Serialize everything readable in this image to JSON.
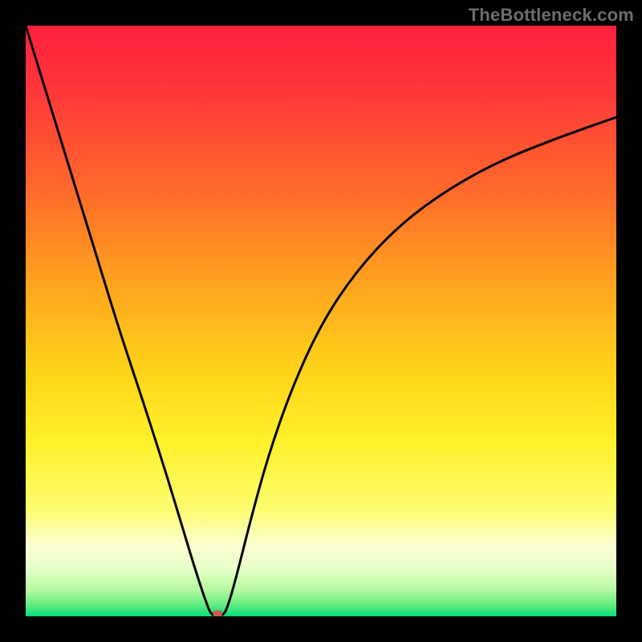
{
  "watermark": "TheBottleneck.com",
  "chart_data": {
    "type": "line",
    "title": "",
    "xlabel": "",
    "ylabel": "",
    "xlim": [
      0,
      100
    ],
    "ylim": [
      0,
      100
    ],
    "grid": false,
    "marker": {
      "x": 32.5,
      "y": 0,
      "color": "#c95c4f",
      "rx": 6,
      "ry": 5
    },
    "gradient_stops": [
      {
        "offset": 0.0,
        "color": "#ff1f3e"
      },
      {
        "offset": 0.12,
        "color": "#ff3a3a"
      },
      {
        "offset": 0.28,
        "color": "#ff6a2a"
      },
      {
        "offset": 0.44,
        "color": "#ffa51f"
      },
      {
        "offset": 0.58,
        "color": "#ffd21a"
      },
      {
        "offset": 0.7,
        "color": "#fff028"
      },
      {
        "offset": 0.82,
        "color": "#fdfd70"
      },
      {
        "offset": 0.88,
        "color": "#fcfed3"
      },
      {
        "offset": 0.92,
        "color": "#e6ffc8"
      },
      {
        "offset": 0.955,
        "color": "#b6f9a1"
      },
      {
        "offset": 0.978,
        "color": "#6dee82"
      },
      {
        "offset": 1.0,
        "color": "#06de7b"
      }
    ],
    "series": [
      {
        "name": "curve",
        "color": "#000000",
        "x": [
          0.0,
          4.0,
          8.0,
          12.0,
          16.0,
          20.0,
          24.0,
          27.0,
          29.0,
          30.5,
          31.5,
          33.5,
          34.5,
          36.0,
          38.0,
          41.0,
          45.0,
          50.0,
          56.0,
          63.0,
          71.0,
          80.0,
          90.0,
          100.0
        ],
        "y": [
          100.0,
          87.0,
          74.0,
          61.0,
          48.0,
          36.0,
          23.5,
          13.5,
          7.0,
          2.5,
          0.0,
          0.0,
          2.5,
          8.0,
          16.0,
          27.0,
          38.5,
          49.5,
          58.5,
          66.0,
          72.0,
          77.0,
          81.0,
          84.5
        ]
      }
    ]
  }
}
